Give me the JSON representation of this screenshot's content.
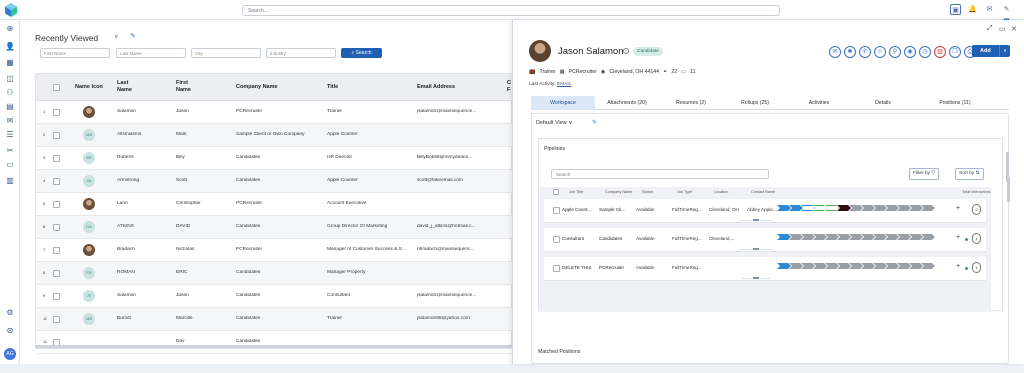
{
  "topbar": {
    "search_placeholder": "Search...",
    "notif_count": "0"
  },
  "main": {
    "title": "Recently Viewed",
    "filters": {
      "first_name": "First Name",
      "last_name": "Last Name",
      "city": "City",
      "industry": "Industry"
    },
    "search_button": "Search",
    "columns": [
      "Name Icon",
      "Last Name",
      "First Name",
      "Company Name",
      "Title",
      "Email Address",
      "C F"
    ],
    "rows": [
      {
        "num": "1",
        "icon": "photo",
        "last": "Salamon",
        "first": "Jason",
        "company": "PCRecruiter",
        "title": "Trainer",
        "email": "jsalamon@mainsequence..."
      },
      {
        "num": "2",
        "icon": "MA",
        "last": "Allsmiasms",
        "first": "Mark",
        "company": "Sample Client or Own Company",
        "title": "Apple Counter",
        "email": ""
      },
      {
        "num": "3",
        "icon": "BR",
        "last": "Roberts",
        "first": "Billy",
        "company": "Candidates",
        "title": "HR Director",
        "email": "BillyBob55@mmydeans..."
      },
      {
        "num": "4",
        "icon": "SA",
        "last": "Armstrong",
        "first": "Scott",
        "company": "Candidates",
        "title": "Apple Counter",
        "email": "scott@fakeemail.com"
      },
      {
        "num": "5",
        "icon": "photo",
        "last": "Lann",
        "first": "Christopher",
        "company": "PCRecruiter",
        "title": "Account Executive",
        "email": ""
      },
      {
        "num": "6",
        "icon": "DA",
        "last": "ATKINS",
        "first": "DAVID",
        "company": "Candidates",
        "title": "Group Director Of Marketing",
        "email": "david_j_atkins@hotmail.c..."
      },
      {
        "num": "7",
        "icon": "photo",
        "last": "Bradach",
        "first": "Nicholas",
        "company": "PCRecruiter",
        "title": "Manager of Customer Success & S...",
        "email": "nbradach@mainsequenc..."
      },
      {
        "num": "8",
        "icon": "ER",
        "last": "ROMAN",
        "first": "ERIC",
        "company": "Candidates",
        "title": "Manager Property",
        "email": ""
      },
      {
        "num": "9",
        "icon": "JS",
        "last": "Salamon",
        "first": "Jason",
        "company": "Candidates",
        "title": "Consultant",
        "email": "jsalamon@mainsequence..."
      },
      {
        "num": "10",
        "icon": "MB",
        "last": "Burnitt",
        "first": "Marcille",
        "company": "Candidates",
        "title": "Trainer",
        "email": "jsalamon95@yahoo.com"
      },
      {
        "num": "11",
        "icon": "",
        "last": "",
        "first": "Dav",
        "company": "Candidates",
        "title": "",
        "email": ""
      }
    ]
  },
  "panel": {
    "name": "Jason Salamon",
    "tag": "Candidate",
    "add_label": "Add",
    "meta": {
      "title": "Trainer",
      "company": "PCRecruiter",
      "location": "Cleveland, OH 44144",
      "count1": "22",
      "count2": "11"
    },
    "last_activity_label": "Last Activity:",
    "last_activity_value": "EMAIL",
    "tabs": [
      "Workspace",
      "Attachments (20)",
      "Resumes (2)",
      "Rollups (25)",
      "Activities",
      "Details",
      "Positions (11)"
    ],
    "view_label": "Default View",
    "pipelines_label": "Pipelines",
    "pipe_search": "Search",
    "filter_by": "Filter by",
    "sort_by": "Sort by",
    "pipe_columns": [
      "Job Title",
      "Company Name",
      "Status",
      "Job Type",
      "Location",
      "Contact Name",
      "Total Interactions"
    ],
    "pipe_rows": [
      {
        "job": "Apple Count...",
        "company": "Sample Cli...",
        "status": "Available",
        "type": "FullTimeReg...",
        "location": "Cleveland, OH",
        "contact": "Abbey Apple...",
        "count": "2"
      },
      {
        "job": "Consultant",
        "company": "Candidates",
        "status": "Available",
        "type": "FullTimeReg...",
        "location": "Cleveland,...",
        "contact": "",
        "count": "1"
      },
      {
        "job": "DELETE THIS",
        "company": "PCRecruiter",
        "status": "Available",
        "type": "FullTimeReg...",
        "location": "",
        "contact": "",
        "count": "1"
      }
    ],
    "matched_label": "Matched Positions"
  },
  "colors": {
    "accent": "#1f5fb4",
    "stage_blue": "#2a8ad4",
    "stage_green": "#4caf50",
    "stage_dark": "#2b0f0f",
    "stage_gray": "#9a9ea6"
  }
}
